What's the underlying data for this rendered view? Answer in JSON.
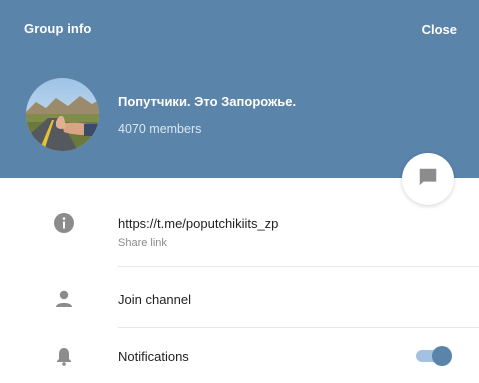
{
  "header": {
    "title": "Group info",
    "close_label": "Close",
    "background_color": "#5b84ab"
  },
  "group": {
    "name": "Попутчики. Это Запорожье.",
    "members": "4070 members"
  },
  "link_row": {
    "icon": "info-icon",
    "url": "https://t.me/poputchikiits_zp",
    "caption": "Share link"
  },
  "join_row": {
    "icon": "user-icon",
    "label": "Join channel"
  },
  "notifications_row": {
    "icon": "bell-icon",
    "label": "Notifications",
    "enabled": true
  },
  "fab": {
    "icon": "message-icon"
  }
}
